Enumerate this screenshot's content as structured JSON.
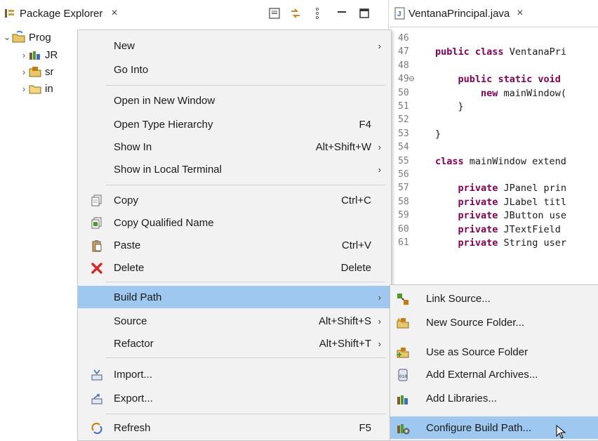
{
  "package_explorer": {
    "tab_label": "Package Explorer",
    "close_glyph": "×",
    "toolbar_icons": [
      "collapse-all-icon",
      "link-with-editor-icon",
      "view-menu-icon",
      "minimize-icon",
      "maximize-icon"
    ],
    "tree": [
      {
        "label": "Prog",
        "icon": "java-project-icon",
        "expanded": true
      },
      {
        "label": "JR",
        "icon": "jre-library-icon"
      },
      {
        "label": "sr",
        "icon": "source-folder-icon"
      },
      {
        "label": "in",
        "icon": "folder-icon"
      }
    ]
  },
  "editor": {
    "tab_label": "VentanaPrincipal.java",
    "close_glyph": "×",
    "lines": [
      {
        "num": "46",
        "code": ""
      },
      {
        "num": "47",
        "code": "public class VentanaPri"
      },
      {
        "num": "48",
        "code": ""
      },
      {
        "num": "49⊖",
        "code": "    public static void"
      },
      {
        "num": "50",
        "code": "        new mainWindow("
      },
      {
        "num": "51",
        "code": "    }"
      },
      {
        "num": "52",
        "code": ""
      },
      {
        "num": "53",
        "code": "}"
      },
      {
        "num": "54",
        "code": ""
      },
      {
        "num": "55",
        "code": "class mainWindow extend"
      },
      {
        "num": "56",
        "code": ""
      },
      {
        "num": "57",
        "code": "    private JPanel prin"
      },
      {
        "num": "58",
        "code": "    private JLabel titl"
      },
      {
        "num": "59",
        "code": "    private JButton use"
      },
      {
        "num": "60",
        "code": "    private JTextField"
      },
      {
        "num": "61",
        "code": "    private String user"
      }
    ]
  },
  "context_menu": {
    "items": [
      {
        "label": "New",
        "accel": "",
        "submenu": true,
        "icon": ""
      },
      {
        "label": "Go Into",
        "accel": "",
        "submenu": false,
        "icon": ""
      },
      {
        "label": "Open in New Window",
        "accel": "",
        "submenu": false,
        "icon": ""
      },
      {
        "label": "Open Type Hierarchy",
        "accel": "F4",
        "submenu": false,
        "icon": ""
      },
      {
        "label": "Show In",
        "accel": "Alt+Shift+W",
        "submenu": true,
        "icon": ""
      },
      {
        "label": "Show in Local Terminal",
        "accel": "",
        "submenu": true,
        "icon": ""
      },
      {
        "label": "Copy",
        "accel": "Ctrl+C",
        "submenu": false,
        "icon": "copy-icon"
      },
      {
        "label": "Copy Qualified Name",
        "accel": "",
        "submenu": false,
        "icon": "copy-qualified-name-icon"
      },
      {
        "label": "Paste",
        "accel": "Ctrl+V",
        "submenu": false,
        "icon": "paste-icon"
      },
      {
        "label": "Delete",
        "accel": "Delete",
        "submenu": false,
        "icon": "delete-icon"
      },
      {
        "label": "Build Path",
        "accel": "",
        "submenu": true,
        "icon": "",
        "highlighted": true
      },
      {
        "label": "Source",
        "accel": "Alt+Shift+S",
        "submenu": true,
        "icon": ""
      },
      {
        "label": "Refactor",
        "accel": "Alt+Shift+T",
        "submenu": true,
        "icon": ""
      },
      {
        "label": "Import...",
        "accel": "",
        "submenu": false,
        "icon": "import-icon"
      },
      {
        "label": "Export...",
        "accel": "",
        "submenu": false,
        "icon": "export-icon"
      },
      {
        "label": "Refresh",
        "accel": "F5",
        "submenu": false,
        "icon": "refresh-icon"
      }
    ],
    "arrow_glyph": "›"
  },
  "build_path_submenu": {
    "items": [
      {
        "label": "Link Source...",
        "icon": "link-source-icon"
      },
      {
        "label": "New Source Folder...",
        "icon": "new-source-folder-icon"
      },
      {
        "label": "Use as Source Folder",
        "icon": "use-as-source-folder-icon"
      },
      {
        "label": "Add External Archives...",
        "icon": "add-external-archives-icon"
      },
      {
        "label": "Add Libraries...",
        "icon": "add-libraries-icon"
      },
      {
        "label": "Configure Build Path...",
        "icon": "configure-build-path-icon",
        "highlighted": true
      }
    ]
  },
  "colors": {
    "highlight": "#9fc8f0",
    "menu_bg": "#f2f2f2",
    "keyword": "#7f0055"
  }
}
